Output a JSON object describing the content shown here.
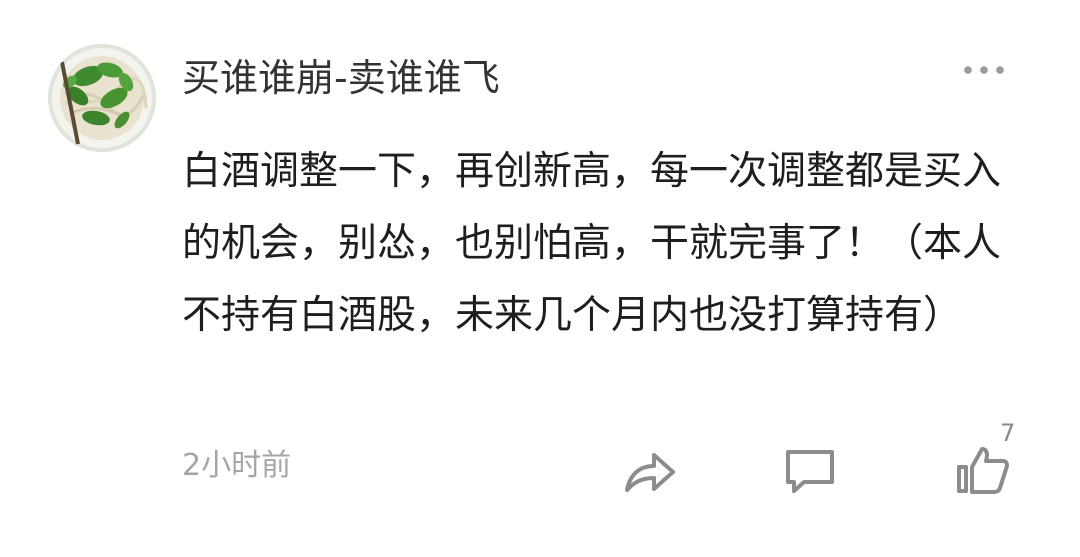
{
  "comment": {
    "username": "买谁谁崩-卖谁谁飞",
    "avatar_icon": "avatar-noodle-bowl-photo",
    "text": "白酒调整一下，再创新高，每一次调整都是买入的机会，别怂，也别怕高，干就完事了！（本人不持有白酒股，未来几个月内也没打算持有）",
    "time": "2小时前",
    "like_count": "7"
  },
  "icons": {
    "more": "more-dots-icon",
    "share": "share-arrow-icon",
    "reply": "comment-bubble-icon",
    "like": "thumbs-up-icon"
  },
  "colors": {
    "text": "#1e1e1e",
    "username": "#333333",
    "muted": "#a6a6a6",
    "icon": "#8c8c8c"
  }
}
